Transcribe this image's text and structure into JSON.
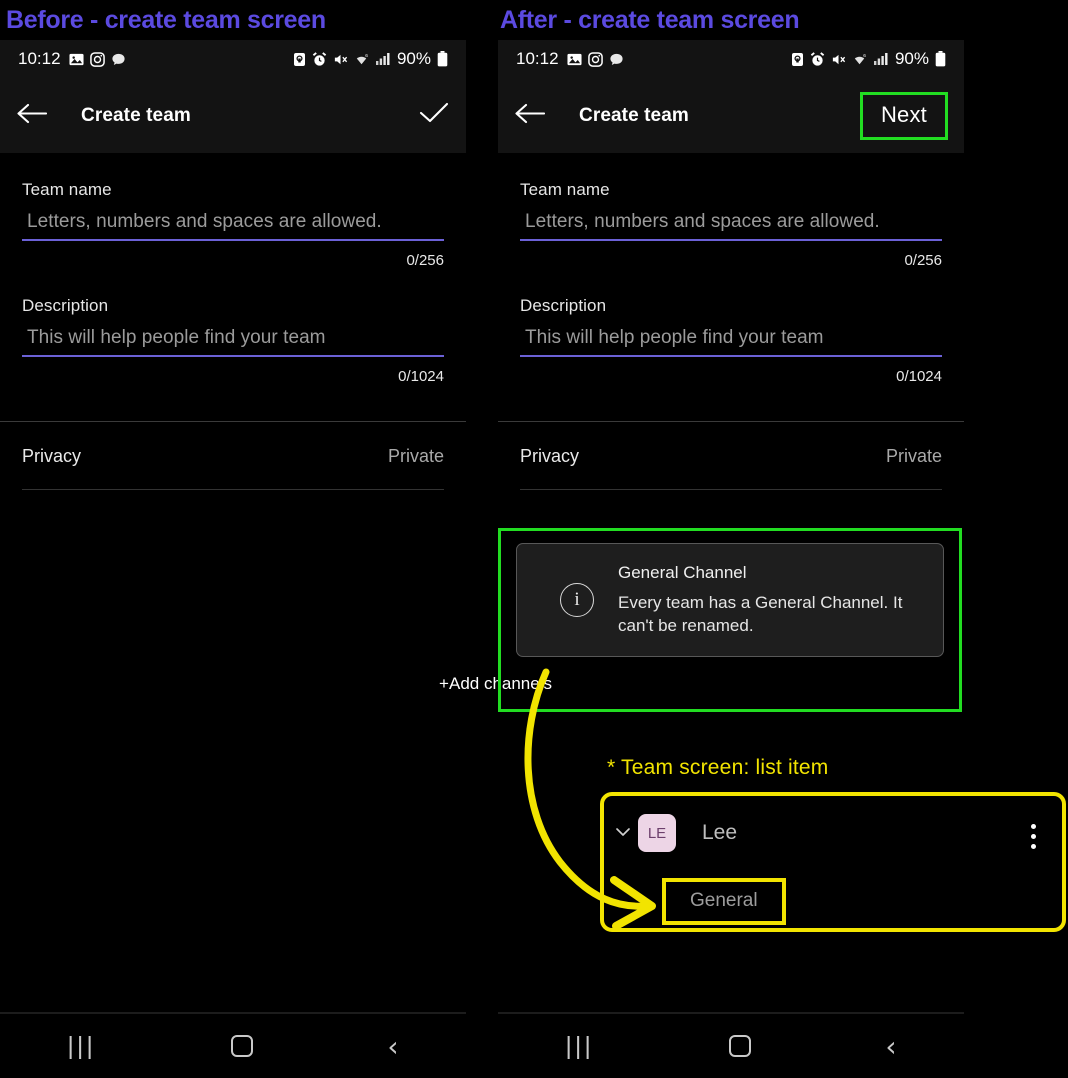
{
  "captions": {
    "before": "Before - create team screen",
    "after": "After - create team screen",
    "color": "#5b4ae0"
  },
  "statusbar": {
    "time": "10:12",
    "battery_pct": "90%",
    "left_icons": [
      "photo-icon",
      "instagram-icon",
      "chat-bubble-icon"
    ],
    "right_icons": [
      "secure-lock-icon",
      "alarm-icon",
      "mute-icon",
      "wifi-icon",
      "signal-icon",
      "battery-icon"
    ]
  },
  "appbar": {
    "back_icon": "arrow-left-icon",
    "title": "Create team",
    "before_action_icon": "checkmark-icon",
    "after_action_label": "Next",
    "highlight_color": "#22dd22"
  },
  "form": {
    "team_name": {
      "label": "Team name",
      "placeholder": "Letters, numbers and spaces are allowed.",
      "counter": "0/256"
    },
    "description": {
      "label": "Description",
      "placeholder": "This will help people find your team",
      "counter": "0/1024"
    },
    "privacy": {
      "label": "Privacy",
      "value": "Private"
    }
  },
  "general_channel": {
    "info_icon": "info-circle-icon",
    "title": "General Channel",
    "body": "Every team has a General Channel. It can't be renamed.",
    "add_channels": "+Add channels"
  },
  "annotation": {
    "note": "* Team screen: list item",
    "color": "#f2e400",
    "arrow": "curved-arrow-icon"
  },
  "list_item": {
    "chevron_icon": "chevron-down-icon",
    "avatar_initials": "LE",
    "avatar_color": "#edd5e6",
    "team_name": "Lee",
    "overflow_icon": "kebab-menu-icon",
    "channel": "General"
  },
  "navbar": {
    "recents_icon": "recents-icon",
    "recents_glyph": "|||",
    "home_icon": "home-icon",
    "back_icon": "back-chevron-icon",
    "back_glyph": "‹"
  }
}
